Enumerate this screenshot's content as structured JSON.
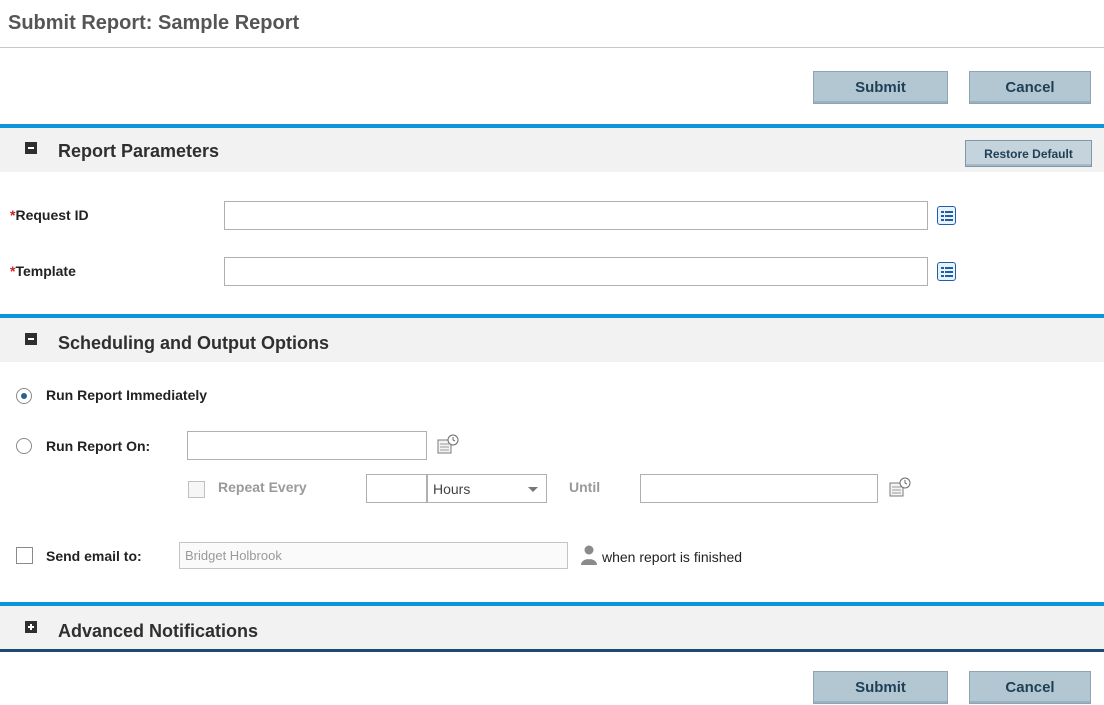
{
  "page": {
    "title": "Submit Report: Sample Report"
  },
  "actions": {
    "submit_label": "Submit",
    "cancel_label": "Cancel"
  },
  "report_parameters": {
    "title": "Report Parameters",
    "restore_default_label": "Restore Default",
    "required_marker": "*",
    "fields": [
      {
        "label": "Request ID",
        "value": "",
        "icon": "list-picker-icon"
      },
      {
        "label": "Template",
        "value": "",
        "icon": "list-picker-icon"
      }
    ]
  },
  "scheduling": {
    "title": "Scheduling and Output Options",
    "run_immediately_label": "Run Report Immediately",
    "run_immediately_selected": true,
    "run_on_label": "Run Report On:",
    "run_on_value": "",
    "repeat_every_label": "Repeat Every",
    "repeat_every_value": "",
    "repeat_unit": "Hours",
    "until_label": "Until",
    "until_value": "",
    "send_email_label": "Send email to:",
    "send_email_value": "Bridget Holbrook",
    "when_finished_label": "when report is finished"
  },
  "advanced_notifications": {
    "title": "Advanced Notifications",
    "expanded": false
  },
  "colors": {
    "accent": "#0a96d8",
    "button": "#b3c7d3",
    "required": "#cc2222"
  }
}
